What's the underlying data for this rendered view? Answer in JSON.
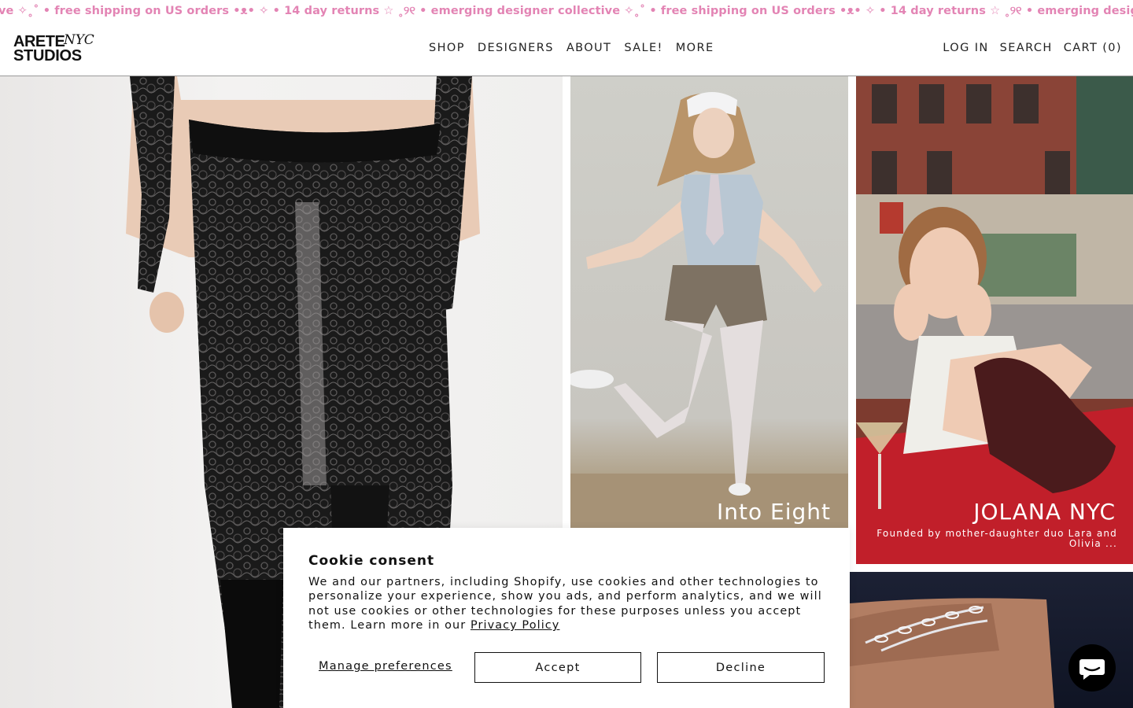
{
  "announcement": {
    "text": "ve ✧˳˚ • free shipping on US orders •ᴥ• ✧ • 14 day returns ☆ ˳୨୧ •  emerging designer collective ✧˳˚ • free shipping on US orders •ᴥ• ✧ • 14 day returns ☆ ˳୨୧ •  emerging designer collective ✧˳˚ • free shipp",
    "color": "#e384b4"
  },
  "header": {
    "logo": {
      "line1": "ARETE",
      "line2": "STUDIOS",
      "script": "NYC"
    },
    "nav": [
      "SHOP",
      "DESIGNERS",
      "ABOUT",
      "SALE!",
      "MORE"
    ],
    "actions": {
      "login": "LOG IN",
      "search": "SEARCH",
      "cart": "CART (0)"
    }
  },
  "tiles": {
    "featured_b": {
      "title": "Into Eight"
    },
    "featured_c": {
      "title": "JOLANA NYC",
      "subtitle": "Founded by mother-daughter duo Lara and Olivia ..."
    }
  },
  "cookie": {
    "title": "Cookie consent",
    "body_text": "We and our partners, including Shopify, use cookies and other technologies to personalize your experience, show you ads, and perform analytics, and we will not use cookies or other technologies for these purposes unless you accept them. Learn more in our ",
    "privacy_link": "Privacy Policy",
    "manage": "Manage preferences",
    "accept": "Accept",
    "decline": "Decline"
  },
  "chat": {
    "icon": "chat-bubble-icon"
  }
}
